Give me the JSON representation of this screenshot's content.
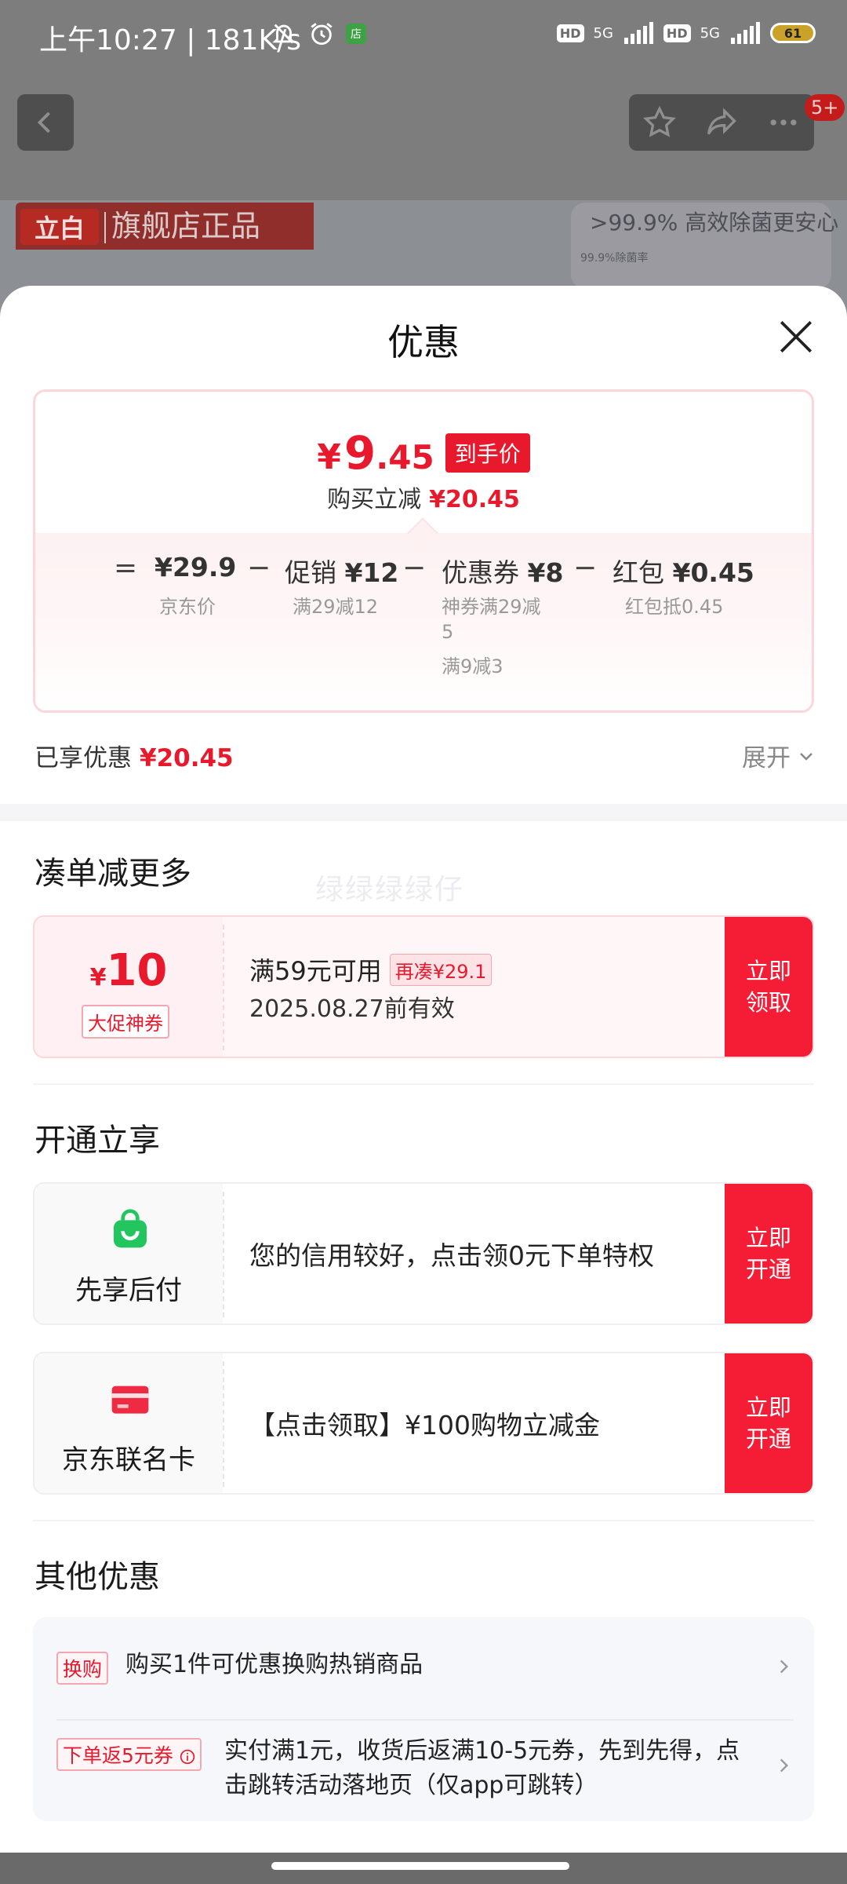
{
  "status_bar": {
    "time": "上午10:27 | 181K/s",
    "hd1": "HD",
    "net1": "5G",
    "hd2": "HD",
    "net2": "5G",
    "battery": "61"
  },
  "nav": {
    "badge": "5+"
  },
  "background": {
    "logo": "立白",
    "flagship": "旗舰店正品",
    "promo": ">99.9% 高效除菌更安心",
    "promo_sub": "99.9%除菌率"
  },
  "sheet": {
    "title": "优惠",
    "final_price": {
      "yen": "¥",
      "int": "9",
      "dec": ".45",
      "tag": "到手价"
    },
    "reduce_label": "购买立减",
    "reduce_amount": "¥20.45",
    "calc": {
      "eq": "=",
      "minus": "−",
      "jd_price": "¥29.9",
      "jd_price_label": "京东价",
      "promo_label": "促销",
      "promo_value": "¥12",
      "promo_sub": "满29减12",
      "coupon_label": "优惠券",
      "coupon_value": "¥8",
      "coupon_sub1": "神券满29减",
      "coupon_sub1b": "5",
      "coupon_sub2": "满9减3",
      "redpack_label": "红包",
      "redpack_value": "¥0.45",
      "redpack_sub": "红包抵0.45"
    },
    "saved_label": "已享优惠",
    "saved_amount": "¥20.45",
    "expand_label": "展开"
  },
  "combine": {
    "title": "凑单减更多",
    "watermark": "绿绿绿绿仔",
    "coupon": {
      "yen": "¥",
      "value": "10",
      "tag": "大促神券",
      "condition": "满59元可用",
      "extra": "再凑¥29.1",
      "valid": "2025.08.27前有效",
      "button_l1": "立即",
      "button_l2": "领取"
    }
  },
  "activate": {
    "title": "开通立享",
    "items": [
      {
        "name": "先享后付",
        "text": "您的信用较好，点击领0元下单特权",
        "button_l1": "立即",
        "button_l2": "开通"
      },
      {
        "name": "京东联名卡",
        "text": "【点击领取】¥100购物立减金",
        "button_l1": "立即",
        "button_l2": "开通"
      }
    ]
  },
  "others": {
    "title": "其他优惠",
    "items": [
      {
        "tag": "换购",
        "text": "购买1件可优惠换购热销商品"
      },
      {
        "tag": "下单返5元券",
        "text1": "实付满1元，收货后返满10-5元券，先到先得，点",
        "text2": "击跳转活动落地页（仅app可跳转）"
      }
    ]
  },
  "colors": {
    "accent": "#e8192c",
    "button": "#f51d36",
    "svc_green": "#22c55e"
  }
}
